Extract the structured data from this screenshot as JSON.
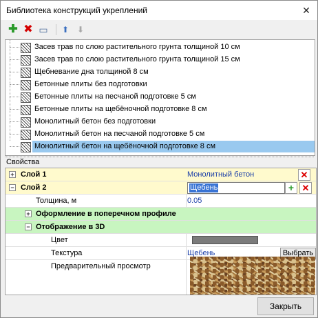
{
  "window": {
    "title": "Библиотека конструкций укреплений",
    "close_glyph": "✕"
  },
  "toolbar": {
    "add_icon": "plus-icon",
    "delete_icon": "delete-icon",
    "rename_icon": "rename-icon",
    "up_icon": "arrow-up-icon",
    "down_icon": "arrow-down-icon",
    "add_glyph": "✚",
    "delete_glyph": "✖",
    "rename_glyph": "▭",
    "up_glyph": "⬆",
    "down_glyph": "⬇"
  },
  "list": {
    "items": [
      {
        "label": "Засев трав по слою растительного грунта толщиной 10 см"
      },
      {
        "label": "Засев трав по слою растительного грунта толщиной 15 см"
      },
      {
        "label": "Щебневание дна толщиной 8 см"
      },
      {
        "label": "Бетонные плиты без подготовки"
      },
      {
        "label": "Бетонные плиты на песчаной подготовке 5 см"
      },
      {
        "label": "Бетонные плиты на щебёночной подготовке 8 см"
      },
      {
        "label": "Монолитный бетон без подготовки"
      },
      {
        "label": "Монолитный бетон на песчаной подготовке 5 см"
      },
      {
        "label": "Монолитный бетон на щебёночной подготовке 8 см"
      }
    ],
    "selected_index": 8
  },
  "properties": {
    "caption": "Свойства",
    "layer1": {
      "name": "Слой 1",
      "value": "Монолитный бетон",
      "expander": "+"
    },
    "layer2": {
      "name": "Слой 2",
      "value": "Щебень",
      "expander": "−"
    },
    "thickness": {
      "name": "Толщина, м",
      "value": "0.05"
    },
    "profile": {
      "name": "Оформление в поперечном профиле",
      "expander": "+"
    },
    "display3d": {
      "name": "Отображение в 3D",
      "expander": "−"
    },
    "color": {
      "name": "Цвет",
      "value": "#7b7b7b"
    },
    "texture": {
      "name": "Текстура",
      "value": "Щебень",
      "button": "Выбрать"
    },
    "preview": {
      "name": "Предварительный просмотр"
    }
  },
  "colors": {
    "group_bg": "#fffacd",
    "green_bg": "#c8f5c0",
    "selection": "#99c9ef"
  },
  "footer": {
    "close_label": "Закрыть"
  }
}
